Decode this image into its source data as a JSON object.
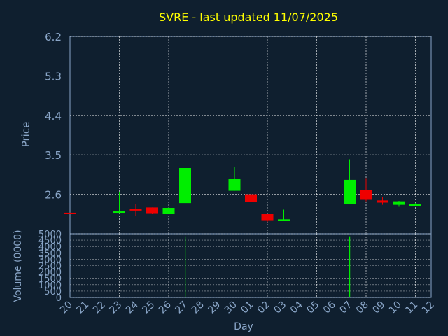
{
  "title": "SVRE - last updated 11/07/2025",
  "colors": {
    "background": "#0f1f2f",
    "plot_bg": "#0f1f2f",
    "title": "#ffff00",
    "axis_text": "#8aa6c8",
    "grid": "#ffffff",
    "up": "#00ee00",
    "down": "#ee0000"
  },
  "chart_data": [
    {
      "type": "candlestick",
      "ylabel": "Price",
      "ylim": [
        1.7,
        6.2
      ],
      "yticks": [
        2.6,
        3.5,
        4.4,
        5.3,
        6.2
      ],
      "ytick_labels": [
        "2.6",
        "3.5",
        "4.4",
        "5.3",
        "6.2"
      ],
      "x_labels": [
        "20",
        "21",
        "22",
        "23",
        "24",
        "25",
        "26",
        "27",
        "28",
        "29",
        "30",
        "01",
        "02",
        "03",
        "04",
        "05",
        "06",
        "07",
        "08",
        "09",
        "10",
        "11",
        "12"
      ],
      "candles": [
        {
          "x": "20",
          "open": 2.18,
          "high": 2.18,
          "low": 2.16,
          "close": 2.16
        },
        {
          "x": "23",
          "open": 2.19,
          "high": 2.66,
          "low": 2.17,
          "close": 2.21
        },
        {
          "x": "24",
          "open": 2.26,
          "high": 2.38,
          "low": 2.1,
          "close": 2.24
        },
        {
          "x": "25",
          "open": 2.3,
          "high": 2.3,
          "low": 2.16,
          "close": 2.17
        },
        {
          "x": "26",
          "open": 2.16,
          "high": 2.3,
          "low": 2.16,
          "close": 2.29
        },
        {
          "x": "27",
          "open": 2.4,
          "high": 5.68,
          "low": 2.35,
          "close": 3.2
        },
        {
          "x": "30",
          "open": 2.68,
          "high": 3.22,
          "low": 2.68,
          "close": 2.95
        },
        {
          "x": "01",
          "open": 2.6,
          "high": 2.6,
          "low": 2.43,
          "close": 2.43
        },
        {
          "x": "02",
          "open": 2.15,
          "high": 2.15,
          "low": 1.97,
          "close": 2.01
        },
        {
          "x": "03",
          "open": 2.01,
          "high": 2.25,
          "low": 2.01,
          "close": 2.03
        },
        {
          "x": "07",
          "open": 2.37,
          "high": 3.4,
          "low": 2.37,
          "close": 2.93
        },
        {
          "x": "08",
          "open": 2.7,
          "high": 2.97,
          "low": 2.44,
          "close": 2.49
        },
        {
          "x": "09",
          "open": 2.46,
          "high": 2.53,
          "low": 2.36,
          "close": 2.41
        },
        {
          "x": "10",
          "open": 2.36,
          "high": 2.45,
          "low": 2.33,
          "close": 2.44
        },
        {
          "x": "11",
          "open": 2.36,
          "high": 2.4,
          "low": 2.35,
          "close": 2.37
        }
      ]
    },
    {
      "type": "bar",
      "ylabel": "Volume (0000)",
      "xlabel": "Day",
      "ylim": [
        0,
        5000
      ],
      "yticks": [
        0,
        500,
        1000,
        1500,
        2000,
        2500,
        3000,
        3500,
        4000,
        4500,
        5000
      ],
      "ytick_labels": [
        "0",
        "500",
        "1000",
        "1500",
        "2000",
        "2500",
        "3000",
        "3500",
        "4000",
        "4500",
        "5000"
      ],
      "bars": [
        {
          "x": "27",
          "value": 4800
        },
        {
          "x": "07",
          "value": 4800
        }
      ]
    }
  ]
}
